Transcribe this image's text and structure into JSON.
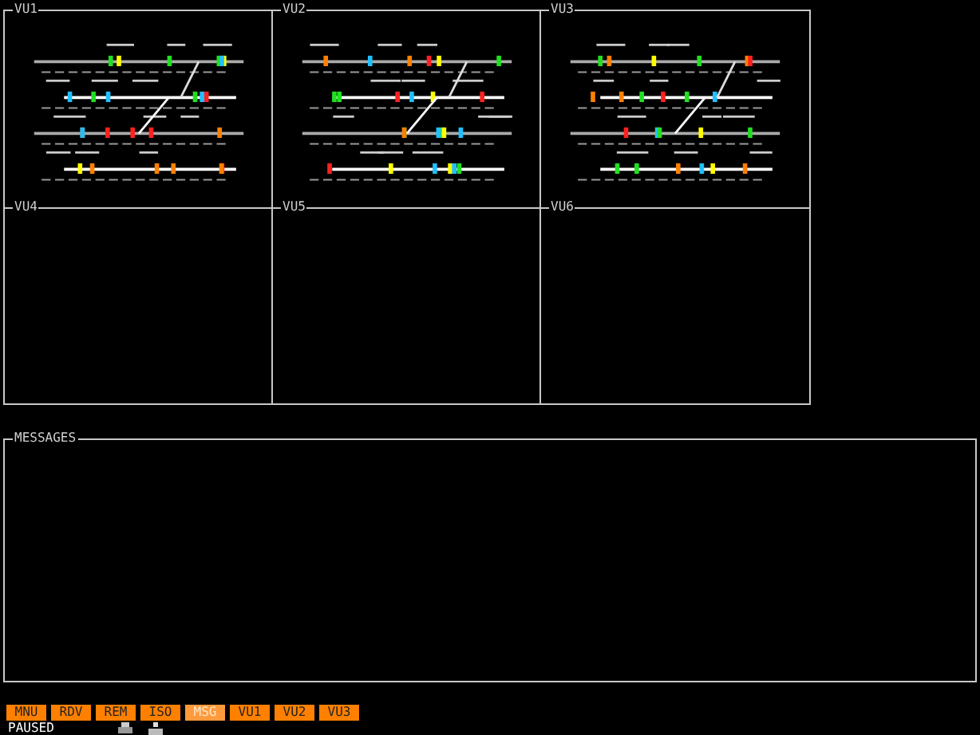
{
  "views": [
    {
      "title": "VU1",
      "kind": "diagram"
    },
    {
      "title": "VU2",
      "kind": "diagram"
    },
    {
      "title": "VU3",
      "kind": "diagram"
    },
    {
      "title": "VU4",
      "kind": "empty"
    },
    {
      "title": "VU5",
      "kind": "empty"
    },
    {
      "title": "VU6",
      "kind": "empty"
    }
  ],
  "messages": {
    "title": "MESSAGES"
  },
  "buttons": [
    {
      "label": "MNU",
      "selected": false
    },
    {
      "label": "RDV",
      "selected": false
    },
    {
      "label": "REM",
      "selected": false
    },
    {
      "label": "ISO",
      "selected": false
    },
    {
      "label": "MSG",
      "selected": true
    },
    {
      "label": "VU1",
      "selected": false
    },
    {
      "label": "VU2",
      "selected": false
    },
    {
      "label": "VU3",
      "selected": false
    }
  ],
  "status": "PAUSED"
}
